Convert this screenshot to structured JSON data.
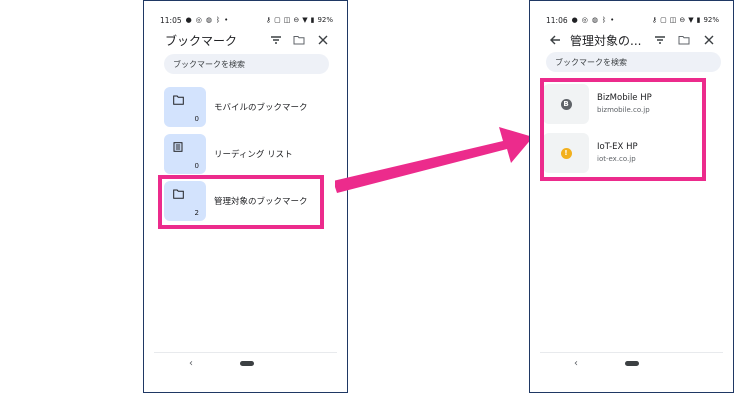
{
  "left_phone": {
    "status": {
      "time": "11:05",
      "battery": "92%"
    },
    "toolbar": {
      "title": "ブックマーク"
    },
    "search": {
      "placeholder": "ブックマークを検索"
    },
    "folders": [
      {
        "label": "モバイルのブックマーク",
        "count": "0",
        "icon": "folder-icon"
      },
      {
        "label": "リーディング リスト",
        "count": "0",
        "icon": "reading-list-icon"
      },
      {
        "label": "管理対象のブックマーク",
        "count": "2",
        "icon": "folder-icon"
      }
    ]
  },
  "right_phone": {
    "status": {
      "time": "11:06",
      "battery": "92%"
    },
    "toolbar": {
      "title": "管理対象の..."
    },
    "search": {
      "placeholder": "ブックマークを検索"
    },
    "bookmarks": [
      {
        "title": "BizMobile HP",
        "url": "bizmobile.co.jp",
        "favicon_letter": "B",
        "favicon_color": "#5f6368"
      },
      {
        "title": "IoT-EX HP",
        "url": "iot-ex.co.jp",
        "favicon_letter": "!",
        "favicon_color": "#f2b01e"
      }
    ]
  },
  "nav": {
    "back_glyph": "‹"
  },
  "colors": {
    "highlight": "#ec2b8c",
    "folder_tile": "#d3e3fd",
    "search_bg": "#eef1f7"
  }
}
